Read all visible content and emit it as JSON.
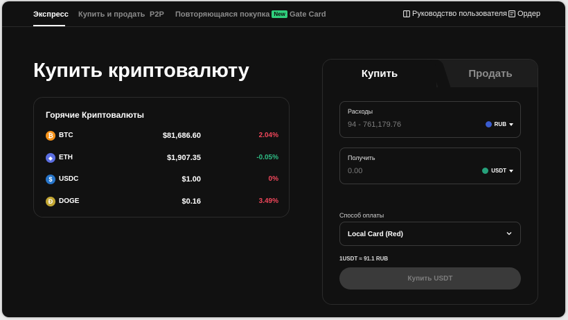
{
  "nav": {
    "tabs": [
      {
        "label": "Экспресс"
      },
      {
        "label": "Купить и продать"
      },
      {
        "label": "P2P"
      },
      {
        "label": "Повторяющаяся покупка",
        "badge": "New"
      },
      {
        "label": "Gate Card"
      }
    ],
    "user_guide": "Руководство пользователя",
    "orders": "Ордер"
  },
  "page_title": "Купить криптовалюту",
  "hot": {
    "title": "Горячие Криптовалюты",
    "coins": [
      {
        "symbol": "BTC",
        "price": "$81,686.60",
        "change": "2.04%",
        "color": "#f7931a",
        "glyph": "₿"
      },
      {
        "symbol": "ETH",
        "price": "$1,907.35",
        "change": "-0.05%",
        "color": "#5b6ee1",
        "glyph": "◆"
      },
      {
        "symbol": "USDC",
        "price": "$1.00",
        "change": "0%",
        "color": "#2775ca",
        "glyph": "$"
      },
      {
        "symbol": "DOGE",
        "price": "$0.16",
        "change": "3.49%",
        "color": "#c2a633",
        "glyph": "Ð"
      }
    ]
  },
  "trade": {
    "tab_buy": "Купить",
    "tab_sell": "Продать",
    "spend": {
      "label": "Расходы",
      "placeholder": "94 - 761,179.76",
      "currency": "RUB"
    },
    "receive": {
      "label": "Получить",
      "placeholder": "0.00",
      "currency": "USDT"
    },
    "payment": {
      "label": "Способ оплаты",
      "value": "Local Card (Red)"
    },
    "rate": "1USDT ≈ 91.1 RUB",
    "buy_button": "Купить USDT"
  },
  "colors": {
    "up": "#f0465a",
    "down": "#2ebd85",
    "badge": "#2fcf7c",
    "usdt": "#26a17b",
    "rub": "#3a5ccf"
  }
}
